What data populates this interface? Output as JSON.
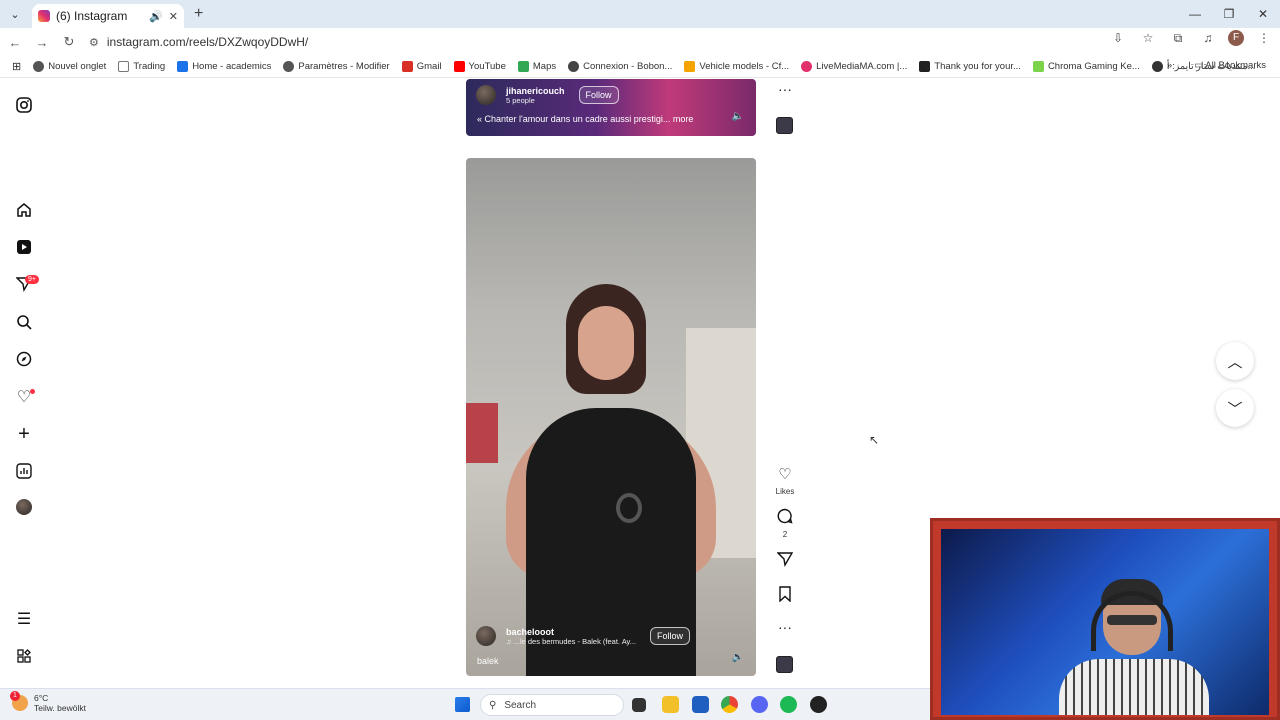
{
  "browser": {
    "tab": {
      "title": "(6) Instagram"
    },
    "url": "instagram.com/reels/DXZwqoyDDwH/",
    "profile_initial": "F",
    "bookmarks": [
      {
        "label": "Nouvel onglet",
        "color": "#555"
      },
      {
        "label": "Trading",
        "color": "#777"
      },
      {
        "label": "Home - academics",
        "color": "#1a73e8"
      },
      {
        "label": "Paramètres - Modifier",
        "color": "#555"
      },
      {
        "label": "Gmail",
        "color": "#d93025"
      },
      {
        "label": "YouTube",
        "color": "#ff0000"
      },
      {
        "label": "Maps",
        "color": "#34a853"
      },
      {
        "label": "Connexion - Bobon...",
        "color": "#444"
      },
      {
        "label": "Vehicle models - Cf...",
        "color": "#f4a300"
      },
      {
        "label": "LiveMediaMA.com |...",
        "color": "#e1306c"
      },
      {
        "label": "Thank you for your...",
        "color": "#222"
      },
      {
        "label": "Chroma Gaming Ke...",
        "color": "#7cd34a"
      },
      {
        "label": "منتديات ستار تايمز: أ...",
        "color": "#333"
      }
    ],
    "all_bookmarks": "All Bookmarks"
  },
  "reels": [
    {
      "username": "jihanericouch",
      "sub": "5 people",
      "follow": "Follow",
      "caption": "« Chanter l'amour dans un cadre aussi prestigi... more"
    },
    {
      "username": "bachelooot",
      "audio": "...le des bermudes - Balek (feat. Ay...",
      "follow": "Follow",
      "caption": "balek"
    }
  ],
  "actions": {
    "likes_label": "Likes",
    "comments_count": "2"
  },
  "taskbar": {
    "temperature": "6°C",
    "weather": "Teilw. bewölkt",
    "badge": "1",
    "search": "Search"
  },
  "notifications_badge": "9+"
}
